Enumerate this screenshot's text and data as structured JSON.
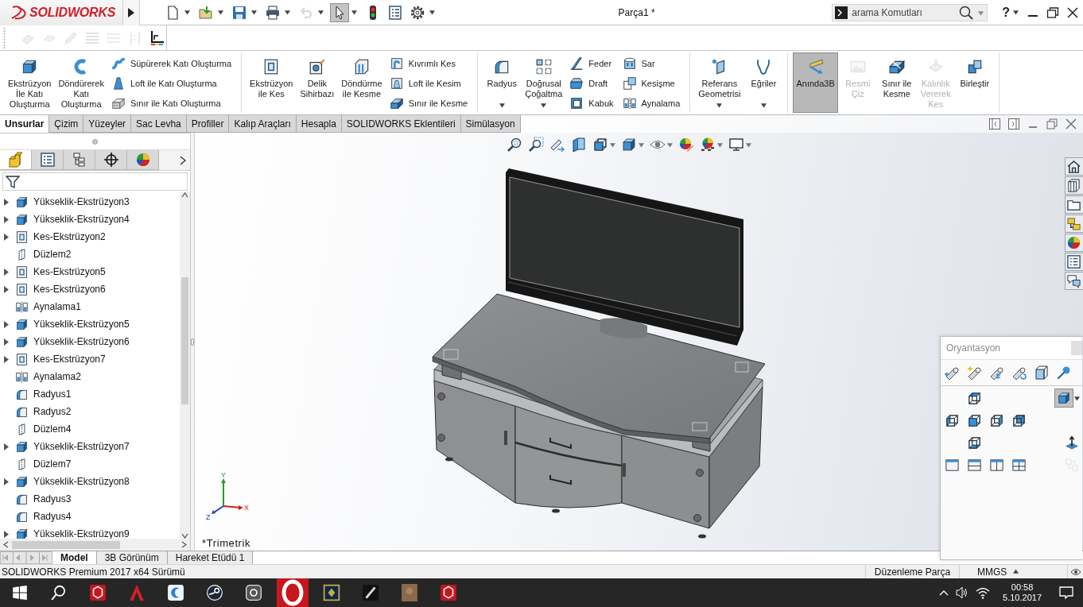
{
  "title_bar": {
    "logo": "SOLIDWORKS",
    "title": "Parça1 *",
    "search": {
      "placeholder": "arama Komutları"
    },
    "help": "?"
  },
  "quick_access": [
    {
      "kind": "new",
      "dropdown": true,
      "disabled": false,
      "selected": false
    },
    {
      "kind": "open",
      "dropdown": true,
      "disabled": false,
      "selected": false
    },
    {
      "kind": "save",
      "dropdown": true,
      "disabled": false,
      "selected": false
    },
    {
      "kind": "print",
      "dropdown": true,
      "disabled": false,
      "selected": false
    },
    {
      "kind": "undo",
      "dropdown": true,
      "disabled": true,
      "selected": false
    },
    {
      "kind": "select",
      "dropdown": true,
      "disabled": false,
      "selected": true
    },
    {
      "kind": "rebuild",
      "dropdown": false,
      "disabled": false,
      "selected": false
    },
    {
      "kind": "fileprops",
      "dropdown": false,
      "disabled": false,
      "selected": false
    },
    {
      "kind": "options",
      "dropdown": true,
      "disabled": false,
      "selected": false
    }
  ],
  "sketch_toolbar": [
    {
      "kind": "eraser",
      "disabled": true
    },
    {
      "kind": "block",
      "disabled": true
    },
    {
      "kind": "pencil",
      "disabled": true
    },
    {
      "kind": "lines",
      "disabled": true
    },
    {
      "kind": "dots",
      "disabled": true
    },
    {
      "kind": "bracket",
      "disabled": true
    },
    {
      "kind": "axes",
      "disabled": false
    }
  ],
  "ribbon": [
    {
      "large": [
        {
          "kind": "extrude",
          "label": "Ekstrüzyon\nİle Katı\nOluşturma",
          "dropdown": false,
          "disabled": false,
          "selected": false
        },
        {
          "kind": "revolve",
          "label": "Döndürerek\nKatı\nOluşturma",
          "dropdown": false,
          "disabled": false,
          "selected": false
        }
      ],
      "small": [
        [
          {
            "kind": "sweep",
            "label": "Süpürerek Katı Oluşturma"
          },
          {
            "kind": "loft",
            "label": "Loft ile Katı Oluşturma"
          },
          {
            "kind": "boundary",
            "label": "Sınır ile Katı Oluşturma"
          }
        ]
      ]
    },
    {
      "large": [
        {
          "kind": "cutextrude",
          "label": "Ekstrüzyon\nile Kes",
          "dropdown": false,
          "disabled": false,
          "selected": false
        },
        {
          "kind": "hole",
          "label": "Delik\nSihirbazı",
          "dropdown": false,
          "disabled": false,
          "selected": false
        },
        {
          "kind": "cutrevolve",
          "label": "Döndürme\nile Kesme",
          "dropdown": false,
          "disabled": false,
          "selected": false
        }
      ],
      "small": [
        [
          {
            "kind": "cutsweep",
            "label": "Kıvrımlı Kes"
          },
          {
            "kind": "cutloft",
            "label": "Loft ile Kesim"
          },
          {
            "kind": "cutboundary",
            "label": "Sınır ile Kesme"
          }
        ]
      ]
    },
    {
      "large": [
        {
          "kind": "fillet",
          "label": "Radyus",
          "dropdown": true,
          "disabled": false,
          "selected": false
        },
        {
          "kind": "pattern",
          "label": "Doğrusal\nÇoğaltma",
          "dropdown": true,
          "disabled": false,
          "selected": false
        }
      ],
      "small": [
        [
          {
            "kind": "rib",
            "label": "Feder"
          },
          {
            "kind": "draft",
            "label": "Draft"
          },
          {
            "kind": "shell",
            "label": "Kabuk"
          }
        ],
        [
          {
            "kind": "wrap",
            "label": "Sar"
          },
          {
            "kind": "intersect",
            "label": "Kesişme"
          },
          {
            "kind": "mirror",
            "label": "Aynalama"
          }
        ]
      ]
    },
    {
      "large": [
        {
          "kind": "reference",
          "label": "Referans\nGeometrisi",
          "dropdown": true,
          "disabled": false,
          "selected": false
        },
        {
          "kind": "curves",
          "label": "Eğriler",
          "dropdown": true,
          "disabled": false,
          "selected": false
        }
      ]
    },
    {
      "large": [
        {
          "kind": "instant",
          "label": "Anında3B",
          "dropdown": false,
          "disabled": false,
          "selected": true
        },
        {
          "kind": "picture",
          "label": "Resmi\nÇiz",
          "dropdown": false,
          "disabled": true,
          "selected": false
        },
        {
          "kind": "split",
          "label": "Sınır ile\nKesme",
          "dropdown": false,
          "disabled": false,
          "selected": false
        },
        {
          "kind": "thicken",
          "label": "Kalınlık\nVererek\nKes",
          "dropdown": false,
          "disabled": true,
          "selected": false
        },
        {
          "kind": "combine",
          "label": "Birleştir",
          "dropdown": false,
          "disabled": false,
          "selected": false
        }
      ]
    }
  ],
  "tabs": [
    {
      "label": "Unsurlar",
      "selected": true
    },
    {
      "label": "Çizim",
      "selected": false
    },
    {
      "label": "Yüzeyler",
      "selected": false
    },
    {
      "label": "Sac Levha",
      "selected": false
    },
    {
      "label": "Profiller",
      "selected": false
    },
    {
      "label": "Kalıp Araçları",
      "selected": false
    },
    {
      "label": "Hesapla",
      "selected": false
    },
    {
      "label": "SOLIDWORKS Eklentileri",
      "selected": false
    },
    {
      "label": "Simülasyon",
      "selected": false
    }
  ],
  "feature_manager": {
    "tabs": [
      {
        "kind": "featuretree",
        "selected": true
      },
      {
        "kind": "propertymanager",
        "selected": false
      },
      {
        "kind": "configmanager",
        "selected": false
      },
      {
        "kind": "dimxpert",
        "selected": false
      },
      {
        "kind": "displaymanager",
        "selected": false
      }
    ],
    "tree": [
      {
        "label": "Yükseklik-Ekstrüzyon3",
        "kind": "extrude",
        "expandable": true
      },
      {
        "label": "Yükseklik-Ekstrüzyon4",
        "kind": "extrude",
        "expandable": true
      },
      {
        "label": "Kes-Ekstrüzyon2",
        "kind": "cutextrude",
        "expandable": true
      },
      {
        "label": "Düzlem2",
        "kind": "plane",
        "expandable": false
      },
      {
        "label": "Kes-Ekstrüzyon5",
        "kind": "cutextrude",
        "expandable": true
      },
      {
        "label": "Kes-Ekstrüzyon6",
        "kind": "cutextrude",
        "expandable": true
      },
      {
        "label": "Aynalama1",
        "kind": "mirror",
        "expandable": false
      },
      {
        "label": "Yükseklik-Ekstrüzyon5",
        "kind": "extrude",
        "expandable": true
      },
      {
        "label": "Yükseklik-Ekstrüzyon6",
        "kind": "extrude",
        "expandable": true
      },
      {
        "label": "Kes-Ekstrüzyon7",
        "kind": "cutextrude",
        "expandable": true
      },
      {
        "label": "Aynalama2",
        "kind": "mirror",
        "expandable": false
      },
      {
        "label": "Radyus1",
        "kind": "fillet",
        "expandable": false
      },
      {
        "label": "Radyus2",
        "kind": "fillet",
        "expandable": false
      },
      {
        "label": "Düzlem4",
        "kind": "plane",
        "expandable": false
      },
      {
        "label": "Yükseklik-Ekstrüzyon7",
        "kind": "extrude",
        "expandable": true
      },
      {
        "label": "Düzlem7",
        "kind": "plane",
        "expandable": false
      },
      {
        "label": "Yükseklik-Ekstrüzyon8",
        "kind": "extrude",
        "expandable": true
      },
      {
        "label": "Radyus3",
        "kind": "fillet",
        "expandable": false
      },
      {
        "label": "Radyus4",
        "kind": "fillet",
        "expandable": false
      },
      {
        "label": "Yükseklik-Ekstrüzyon9",
        "kind": "extrude",
        "expandable": true
      }
    ]
  },
  "viewport": {
    "heads_up_toolbar": [
      {
        "kind": "zoomfit",
        "dropdown": false
      },
      {
        "kind": "zoomarea",
        "dropdown": false
      },
      {
        "kind": "previousview",
        "dropdown": false
      },
      {
        "kind": "sectionview",
        "dropdown": false
      },
      {
        "kind": "vieworientation",
        "dropdown": true
      },
      {
        "kind": "displaystyle",
        "dropdown": true
      },
      {
        "kind": "hideshow",
        "dropdown": true
      },
      {
        "kind": "editappearance",
        "dropdown": false
      },
      {
        "kind": "scene",
        "dropdown": true
      },
      {
        "kind": "viewsettings",
        "dropdown": true
      }
    ],
    "view_name": "*Trimetrik",
    "triad": {
      "x": "X",
      "y": "Y",
      "z": "Z"
    }
  },
  "orientation_panel": {
    "title": "Oryantasyon",
    "side_tools": [
      {
        "kind": "viewselector",
        "dropdown": true,
        "selected": true,
        "disabled": false
      },
      {
        "kind": "normalto",
        "dropdown": false,
        "selected": false,
        "disabled": false
      },
      {
        "kind": "linkviews",
        "dropdown": false,
        "selected": false,
        "disabled": true
      }
    ]
  },
  "bottom_tabs": [
    {
      "label": "Model",
      "selected": true
    },
    {
      "label": "3B Görünüm",
      "selected": false
    },
    {
      "label": "Hareket Etüdü 1",
      "selected": false
    }
  ],
  "status_bar": {
    "version": "SOLIDWORKS Premium 2017 x64 Sürümü",
    "mode": "Düzenleme Parça",
    "units": "MMGS"
  },
  "taskbar": {
    "time": "00:58",
    "date": "5.10.2017"
  }
}
